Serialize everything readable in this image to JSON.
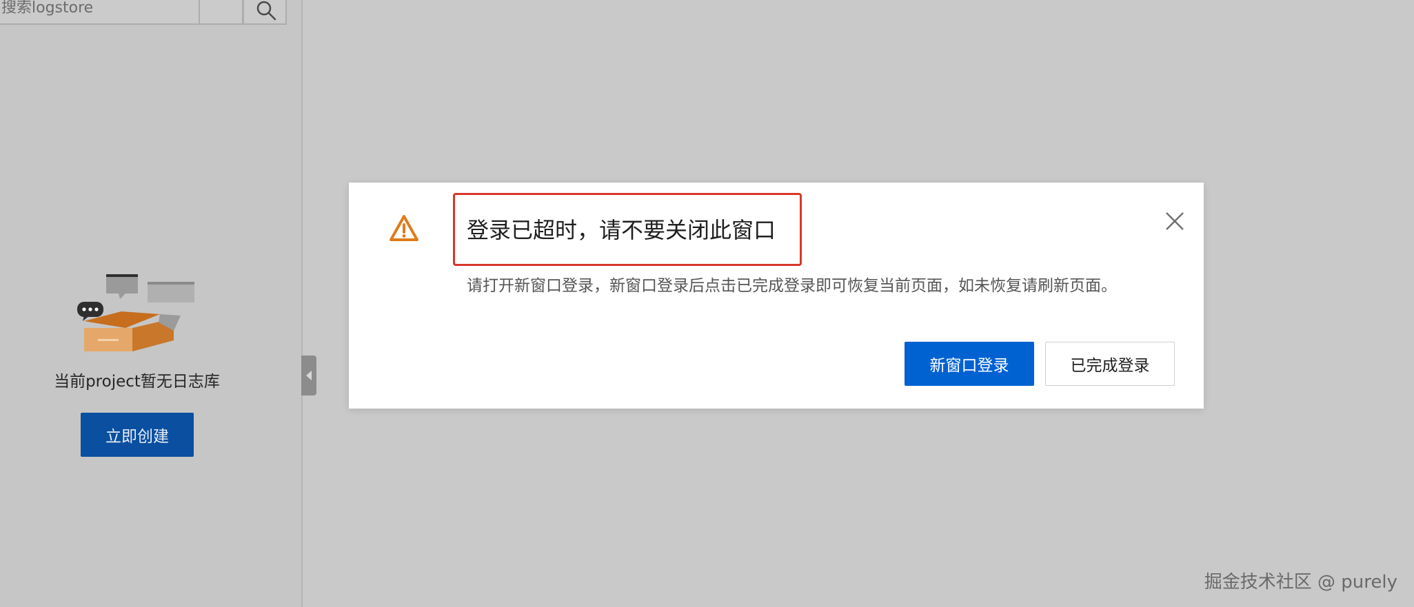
{
  "sidebar": {
    "search_placeholder": "搜索logstore",
    "search_button_icon": "search-icon",
    "empty_text": "当前project暂无日志库",
    "create_button": "立即创建",
    "collapse_icon": "chevron-left-icon"
  },
  "modal": {
    "icon": "warning-icon",
    "title": "登录已超时，请不要关闭此窗口",
    "message": "请打开新窗口登录，新窗口登录后点击已完成登录即可恢复当前页面，如未恢复请刷新页面。",
    "close_icon": "close-icon",
    "primary_button": "新窗口登录",
    "secondary_button": "已完成登录",
    "highlight_color": "#d9362b"
  },
  "colors": {
    "primary_blue": "#0062d1",
    "overlay_gray": "#c9c9c9",
    "warning_orange": "#e07b1a"
  },
  "watermark": "掘金技术社区 @ purely"
}
